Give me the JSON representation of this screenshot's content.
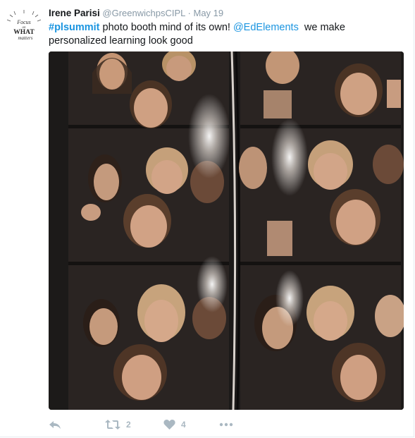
{
  "tweet": {
    "author_name": "Irene Parisi",
    "author_handle": "@GreenwichpsCIPL",
    "separator": "·",
    "date": "May 19",
    "text": {
      "hashtag": "#plsummit",
      "part1": " photo booth mind of its own! ",
      "mention": "@EdElements",
      "part2": "  we make personalized learning look good"
    },
    "avatar": {
      "line1": "Focus",
      "line2": "on",
      "line3": "WHAT",
      "line4": "matters"
    },
    "photo": {
      "icon": "photo-booth-strips",
      "colors": {
        "background": "#1c1a19",
        "strip": "#2b2523",
        "skin": "#c99a7a",
        "hair_blonde": "#b89267",
        "hair_brown": "#4a3324"
      }
    },
    "actions": {
      "reply_icon": "reply-icon",
      "retweet_icon": "retweet-icon",
      "retweet_count": "2",
      "like_icon": "heart-icon",
      "like_count": "4",
      "more_icon": "more-icon"
    }
  },
  "colors": {
    "link": "#1b95e0",
    "meta": "#8899a6",
    "action": "#aab8c2",
    "text": "#14171a"
  }
}
